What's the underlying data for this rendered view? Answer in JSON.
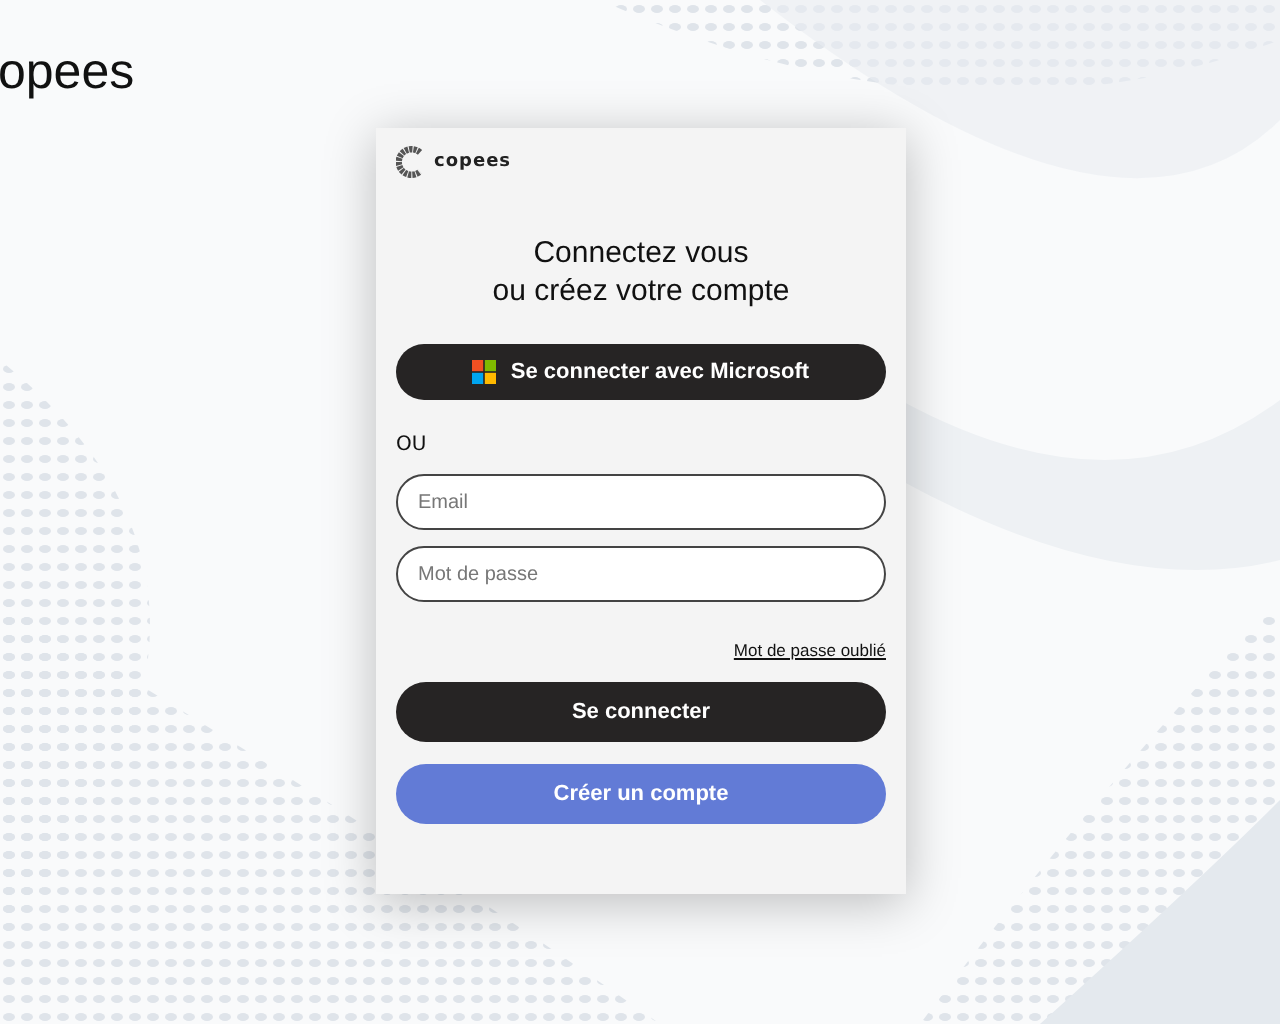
{
  "page_logo": {
    "text": "opees"
  },
  "card": {
    "brand": "copees",
    "title": "Connectez vous\nou créez votre compte",
    "microsoft_button": "Se connecter avec Microsoft",
    "separator": "OU",
    "fields": [
      {
        "placeholder": "Email"
      },
      {
        "placeholder": "Mot de passe"
      }
    ],
    "forgot_link": "Mot de passe oublié",
    "buttons": [
      {
        "kind": "primary",
        "label": "Se connecter"
      },
      {
        "kind": "secondary",
        "label": "Créer un compte"
      }
    ]
  }
}
